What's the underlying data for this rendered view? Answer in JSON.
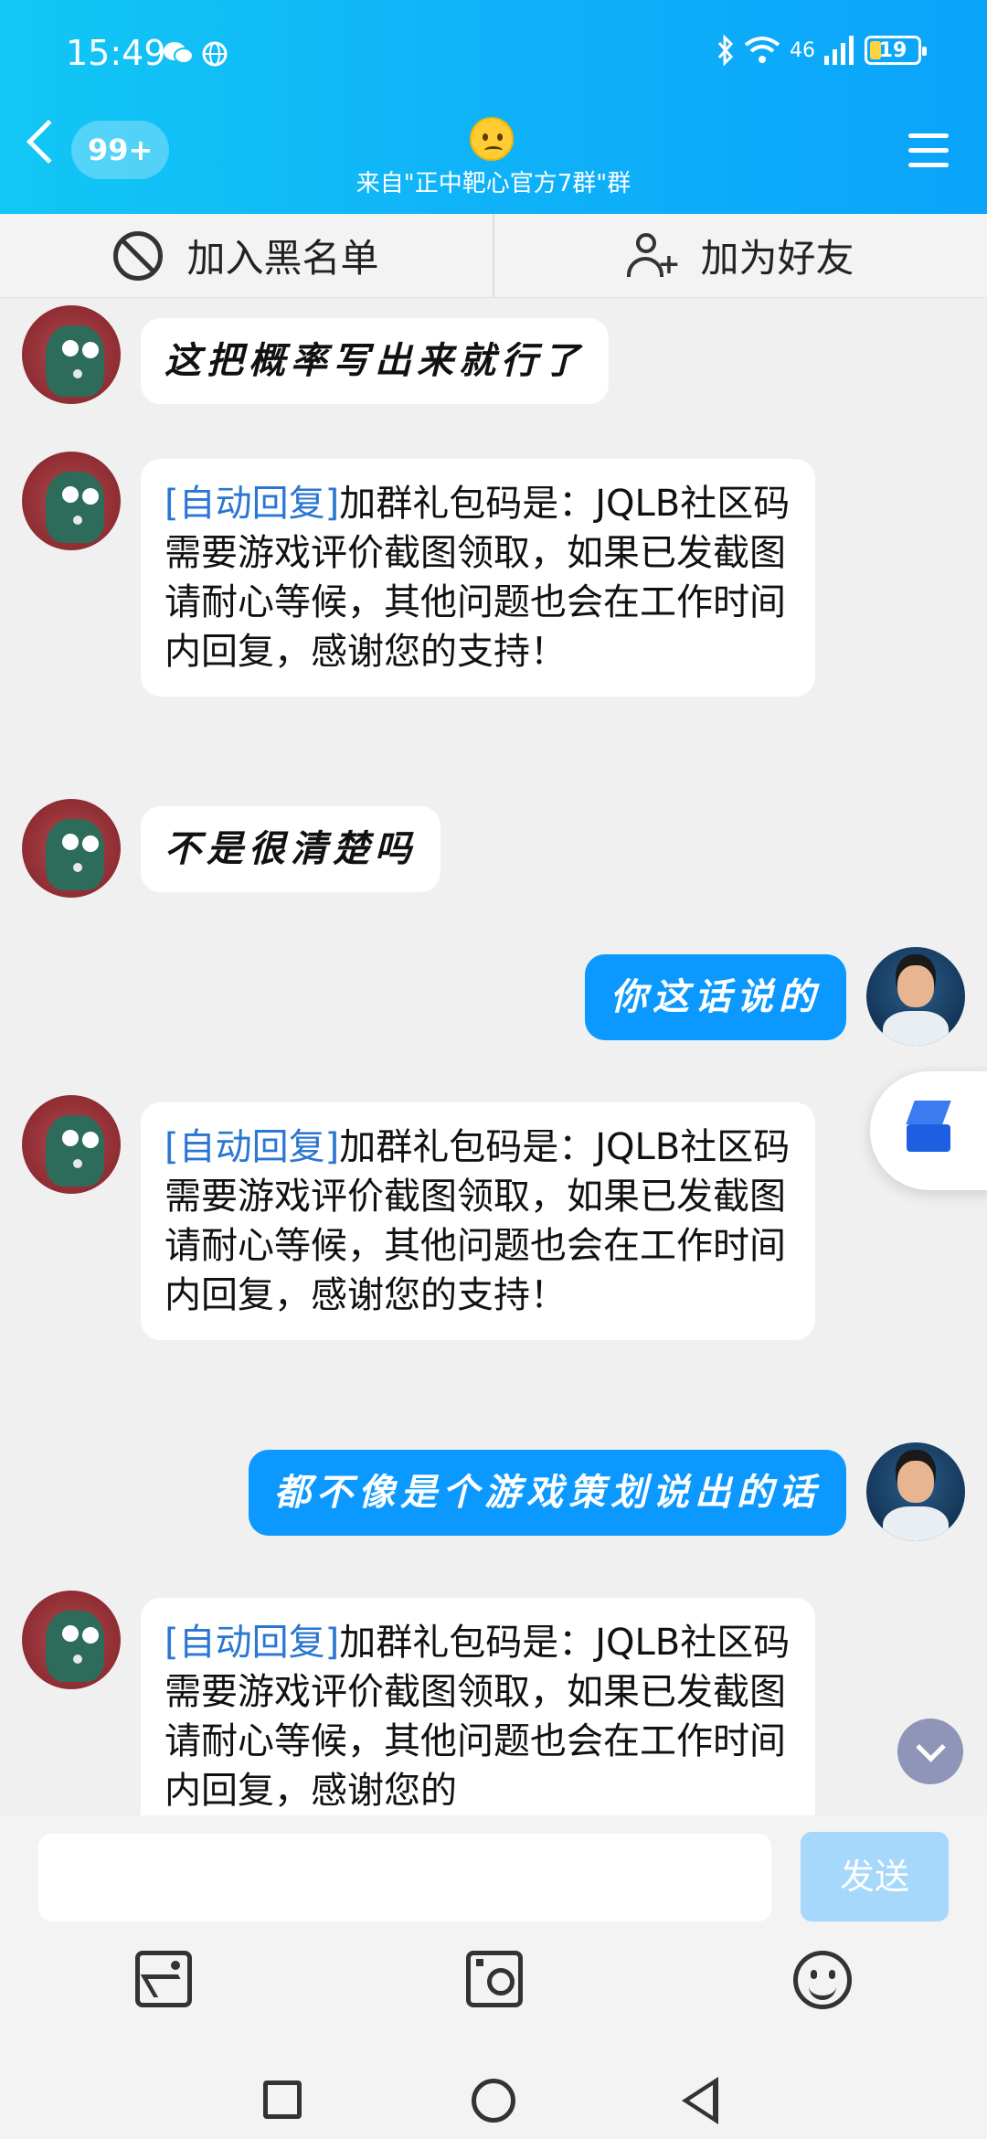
{
  "status_bar": {
    "time": "15:49",
    "network": "46",
    "battery": "19"
  },
  "header": {
    "unread_count": "99+",
    "subtitle": "来自\"正中靶心官方7群\"群"
  },
  "actions": {
    "blacklist_label": "加入黑名单",
    "add_friend_label": "加为好友"
  },
  "messages": [
    {
      "side": "left",
      "text": "这把概率写出来就行了"
    },
    {
      "side": "left",
      "auto_tag": "[自动回复]",
      "text": "加群礼包码是：JQLB社区码需要游戏评价截图领取，如果已发截图请耐心等候，其他问题也会在工作时间内回复，感谢您的支持！"
    },
    {
      "side": "left",
      "text": "不是很清楚吗"
    },
    {
      "side": "right",
      "text": "你这话说的"
    },
    {
      "side": "left",
      "auto_tag": "[自动回复]",
      "text": "加群礼包码是：JQLB社区码需要游戏评价截图领取，如果已发截图请耐心等候，其他问题也会在工作时间内回复，感谢您的支持！"
    },
    {
      "side": "right",
      "text": "都不像是个游戏策划说出的话"
    },
    {
      "side": "left",
      "auto_tag": "[自动回复]",
      "text": "加群礼包码是：JQLB社区码需要游戏评价截图领取，如果已发截图请耐心等候，其他问题也会在工作时间内回复，感谢您的"
    }
  ],
  "input": {
    "value": "",
    "placeholder": "",
    "send_label": "发送"
  },
  "colors": {
    "header": "#0fb2f8",
    "my_bubble": "#0c99ff",
    "auto_tag": "#2a76d2",
    "send_disabled": "#a6d8fb"
  },
  "icons": [
    "wechat-icon",
    "globe-icon",
    "bluetooth-icon",
    "wifi-icon",
    "signal-icon",
    "battery-icon",
    "back-icon",
    "emoji-face-icon",
    "menu-icon",
    "ban-icon",
    "add-user-icon",
    "cube-app-icon",
    "scroll-down-icon",
    "image-icon",
    "camera-icon",
    "emoji-icon"
  ]
}
